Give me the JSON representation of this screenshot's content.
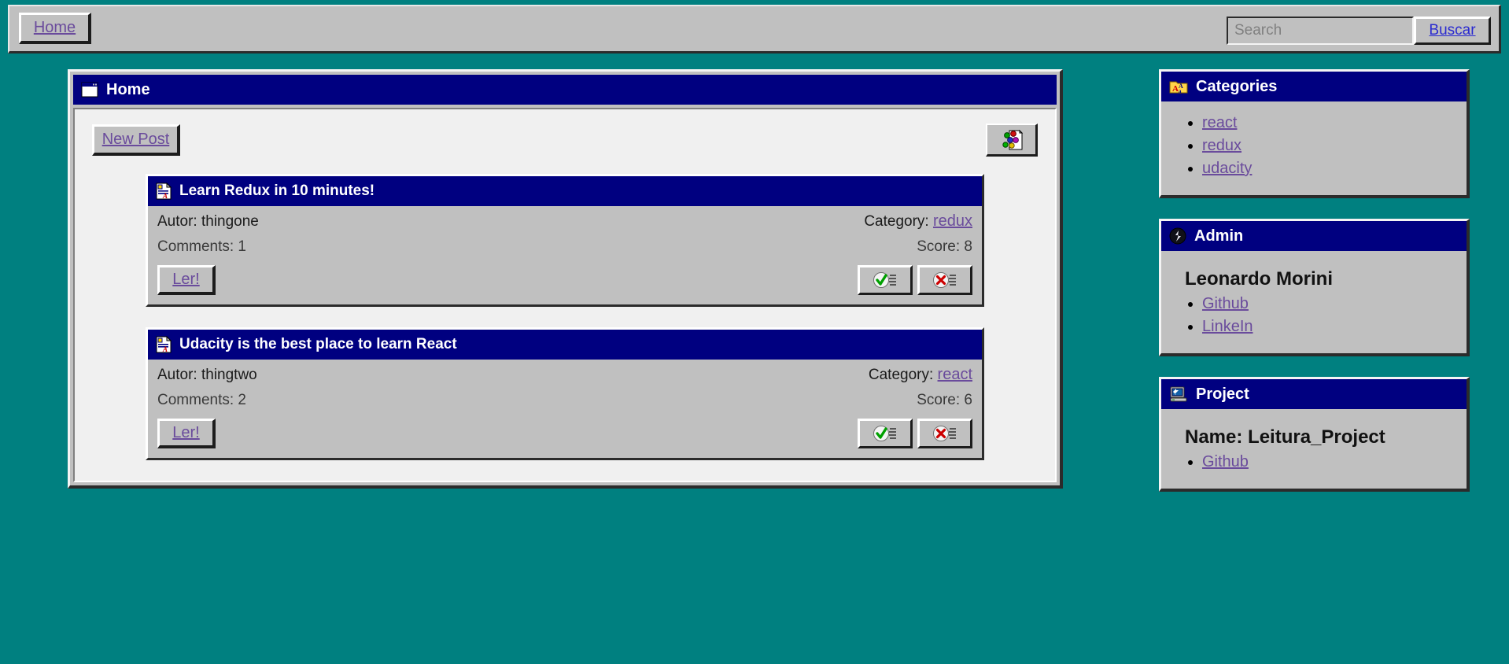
{
  "toolbar": {
    "home_label": "Home",
    "search_placeholder": "Search",
    "search_value": "",
    "search_button_label": "Buscar",
    "search_icon": "search-icon"
  },
  "main_window": {
    "title": "Home",
    "title_icon": "window-icon",
    "new_post_label": "New Post",
    "sort_icon": "sort-posts-icon",
    "posts": [
      {
        "title": "Learn Redux in 10 minutes!",
        "icon": "document-icon",
        "author_label": "Autor: thingone",
        "category_label": "Category:",
        "category": "redux",
        "comments_label": "Comments: 1",
        "score_label": "Score: 8",
        "read_label": "Ler!",
        "upvote_icon": "check-icon",
        "downvote_icon": "cross-icon"
      },
      {
        "title": "Udacity is the best place to learn React",
        "icon": "document-icon",
        "author_label": "Autor: thingtwo",
        "category_label": "Category:",
        "category": "react",
        "comments_label": "Comments: 2",
        "score_label": "Score: 6",
        "read_label": "Ler!",
        "upvote_icon": "check-icon",
        "downvote_icon": "cross-icon"
      }
    ]
  },
  "sidebar": {
    "categories_panel": {
      "title": "Categories",
      "icon": "folder-abc-icon",
      "items": [
        "react",
        "redux",
        "udacity"
      ]
    },
    "admin_panel": {
      "title": "Admin",
      "icon": "user-icon",
      "name": "Leonardo Morini",
      "links": [
        "Github",
        "LinkeIn"
      ]
    },
    "project_panel": {
      "title": "Project",
      "icon": "computer-icon",
      "name": "Name: Leitura_Project",
      "links": [
        "Github"
      ]
    }
  },
  "colors": {
    "desktop": "#008080",
    "chrome": "#c0c0c0",
    "titlebar": "#000080",
    "content": "#f0f0f0",
    "link": "#6a4b9c",
    "search_link": "#2a2ad0"
  }
}
